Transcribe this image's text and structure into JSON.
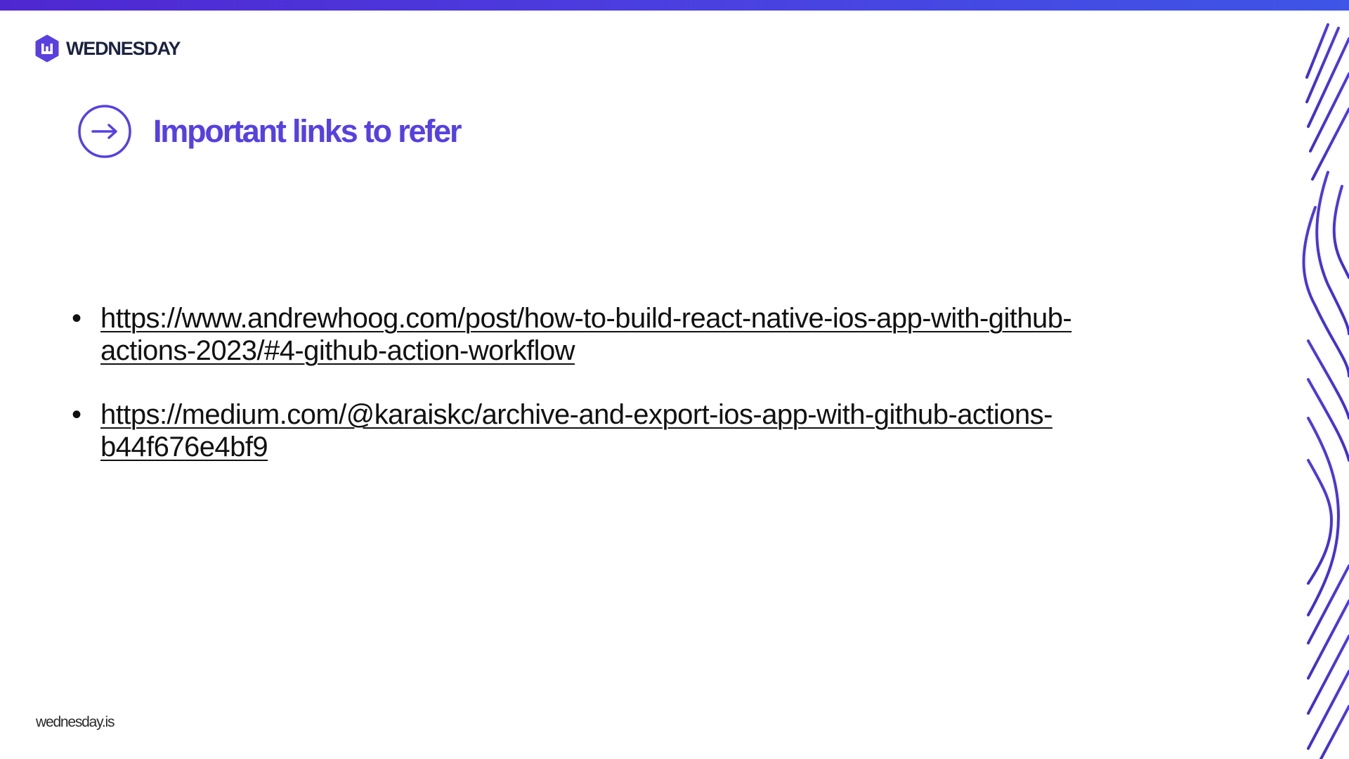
{
  "brand": {
    "logo_icon": "wednesday-w-logo-icon",
    "name": "WEDNESDAY"
  },
  "heading": {
    "icon": "arrow-right-circle-icon",
    "text": "Important links to refer"
  },
  "links": [
    {
      "lines": [
        "https://www.andrewhoog.com/post/how-to-build-react-native-ios-app-with-github-",
        "actions-2023/#4-github-action-workflow"
      ]
    },
    {
      "lines": [
        "https://medium.com/@karaiskc/archive-and-export-ios-app-with-github-actions-",
        "b44f676e4bf9"
      ]
    }
  ],
  "footer": {
    "site": "wednesday.is"
  },
  "colors": {
    "accent": "#5540e3",
    "top_bar_start": "#4f27d1",
    "top_bar_end": "#3e55e6",
    "text": "#111111",
    "brand_text": "#1b2340"
  },
  "decor": {
    "right_edge": "wavy-lines-decoration"
  }
}
